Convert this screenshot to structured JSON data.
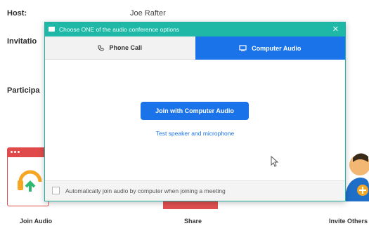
{
  "background": {
    "host_label": "Host:",
    "host_value": "Joe Rafter",
    "invitation_label": "Invitatio",
    "participants_label": "Participa",
    "bottom_labels": {
      "join_audio": "Join Audio",
      "share": "Share",
      "invite_others": "Invite Others"
    }
  },
  "dialog": {
    "title": "Choose ONE of the audio conference options",
    "tabs": [
      {
        "label": "Phone Call",
        "icon": "phone-icon",
        "active": false
      },
      {
        "label": "Computer Audio",
        "icon": "monitor-icon",
        "active": true
      }
    ],
    "join_button": "Join with Computer Audio",
    "test_link": "Test speaker and microphone",
    "auto_join_label": "Automatically join audio by computer when joining a meeting",
    "auto_join_checked": false
  },
  "colors": {
    "titlebar": "#1fb8a7",
    "accent_blue": "#1a73e8",
    "join_tile_red": "#e04a4a",
    "avatar_orange": "#f5a623"
  }
}
